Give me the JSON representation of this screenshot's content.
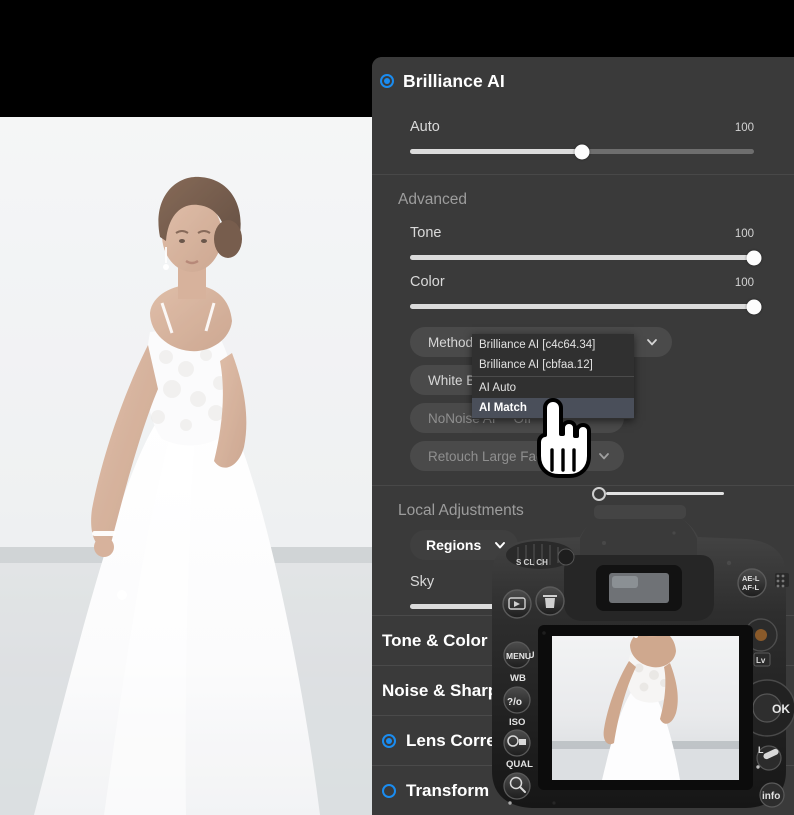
{
  "app": {
    "panel_title": "Brilliance AI",
    "panel_title_radio": "checked"
  },
  "accent_color": "#1a8cf0",
  "panel_bg": "#3a3a3a",
  "auto_section": {
    "slider": {
      "label": "Auto",
      "value": "100",
      "percent": 50
    }
  },
  "advanced_section": {
    "title": "Advanced",
    "sliders": [
      {
        "label": "Tone",
        "value": "100",
        "percent": 100
      },
      {
        "label": "Color",
        "value": "100",
        "percent": 100
      }
    ],
    "controls": [
      {
        "name": "method",
        "label": "Method",
        "value": "",
        "chevron": "chevron-down-icon"
      },
      {
        "name": "white-balance",
        "label": "White Balance",
        "value": "",
        "chevron": "chevron-down-icon"
      },
      {
        "name": "nonoise-ai",
        "label": "NoNoise AI",
        "value": "Off",
        "chevron": ""
      },
      {
        "name": "retouch",
        "label": "Retouch Large Faces",
        "value": "",
        "chevron": "chevron-down-icon"
      }
    ]
  },
  "method_dropdown": {
    "open": true,
    "items": [
      {
        "label": "Brilliance AI [c4c64.34]",
        "selected": false,
        "separator_after": false
      },
      {
        "label": "Brilliance AI [cbfaa.12]",
        "selected": false,
        "separator_after": true
      },
      {
        "label": "AI Auto",
        "selected": false,
        "separator_after": false
      },
      {
        "label": "AI Match",
        "selected": true,
        "separator_after": false
      }
    ]
  },
  "local_section": {
    "title": "Local Adjustments",
    "regions_button": "Regions",
    "regions_chevron": "chevron-down-icon",
    "sky": {
      "label": "Sky",
      "percent": 100
    },
    "top_slider": {
      "percent": 0
    }
  },
  "bottom_tabs": [
    {
      "label": "Tone & Color",
      "radio": "none"
    },
    {
      "label": "Noise & Sharpening",
      "radio": "none"
    },
    {
      "label": "Lens Corrections",
      "radio": "checked"
    },
    {
      "label": "Transform",
      "radio": "unchecked"
    }
  ],
  "images": {
    "main_photo": "bride-portrait-photo",
    "camera_overlay": "dslr-camera-back-photo",
    "camera_lcd": "camera-lcd-preview-photo"
  }
}
